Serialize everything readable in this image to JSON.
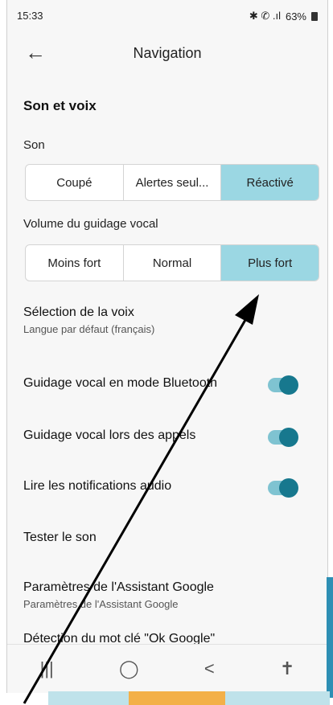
{
  "status": {
    "time": "15:33",
    "icons": "✱ ✆ .ıl",
    "battery": "63%"
  },
  "appbar": {
    "back_icon": "←",
    "title": "Navigation"
  },
  "sound_voice": {
    "section_title": "Son et voix"
  },
  "son": {
    "label": "Son",
    "options": [
      "Coupé",
      "Alertes seul...",
      "Réactivé"
    ],
    "selected": 2
  },
  "volume": {
    "label": "Volume du guidage vocal",
    "options": [
      "Moins fort",
      "Normal",
      "Plus fort"
    ],
    "selected": 2
  },
  "voice_selection": {
    "title": "Sélection de la voix",
    "subtitle": "Langue par défaut (français)"
  },
  "toggles": [
    {
      "label": "Guidage vocal en mode Bluetooth",
      "on": true
    },
    {
      "label": "Guidage vocal lors des appels",
      "on": true
    },
    {
      "label": "Lire les notifications audio",
      "on": true
    }
  ],
  "test_sound": {
    "label": "Tester le son"
  },
  "assistant": {
    "title": "Paramètres de l'Assistant Google",
    "subtitle": "Paramètres de l'Assistant Google"
  },
  "hotword": {
    "title": "Détection du mot clé \"Ok Google\""
  },
  "navbar": {
    "recent": "|||",
    "home": "◯",
    "back": "<",
    "accessibility": "✝"
  },
  "colors": {
    "selected": "#9bd7e3",
    "toggle_track": "#7fc3d1",
    "toggle_knob": "#17788e"
  }
}
